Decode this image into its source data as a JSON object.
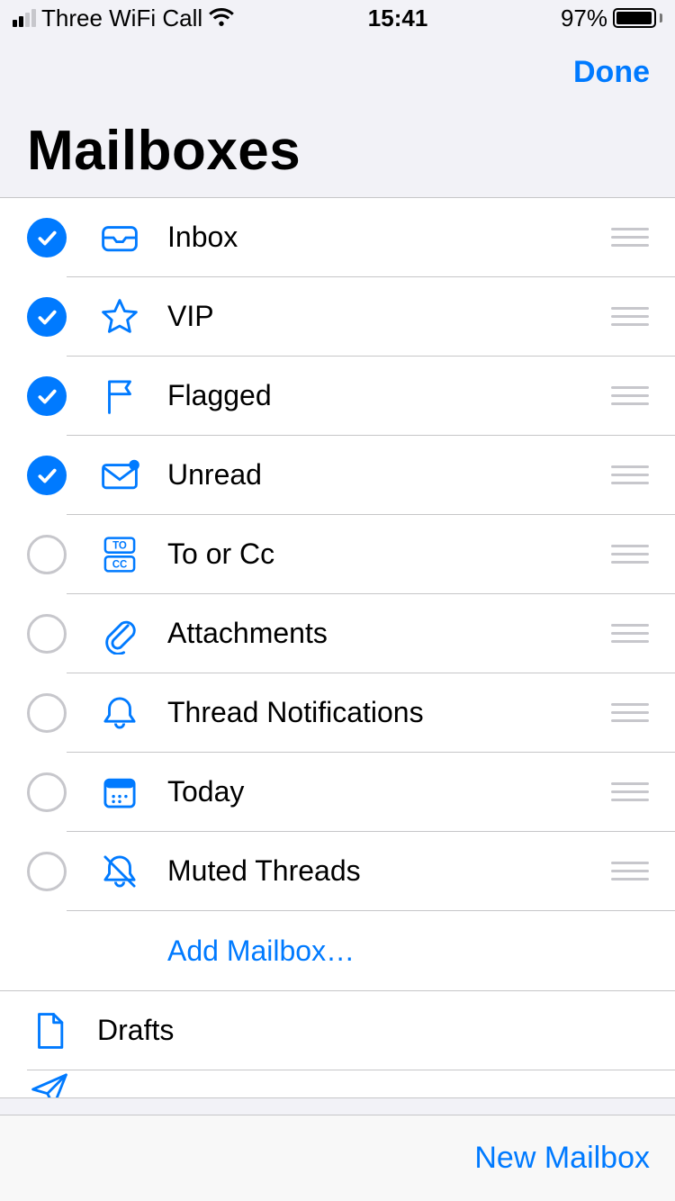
{
  "status_bar": {
    "carrier": "Three WiFi Call",
    "time": "15:41",
    "battery_pct": "97%"
  },
  "nav": {
    "done": "Done",
    "title": "Mailboxes"
  },
  "mailbox_list": [
    {
      "label": "Inbox",
      "icon": "inbox-icon",
      "checked": true
    },
    {
      "label": "VIP",
      "icon": "star-icon",
      "checked": true
    },
    {
      "label": "Flagged",
      "icon": "flag-icon",
      "checked": true
    },
    {
      "label": "Unread",
      "icon": "envelope-dot-icon",
      "checked": true
    },
    {
      "label": "To or Cc",
      "icon": "to-cc-icon",
      "checked": false
    },
    {
      "label": "Attachments",
      "icon": "paperclip-icon",
      "checked": false
    },
    {
      "label": "Thread Notifications",
      "icon": "bell-icon",
      "checked": false
    },
    {
      "label": "Today",
      "icon": "calendar-icon",
      "checked": false
    },
    {
      "label": "Muted Threads",
      "icon": "bell-slash-icon",
      "checked": false
    }
  ],
  "add_mailbox": "Add Mailbox…",
  "secondary_list": [
    {
      "label": "Drafts",
      "icon": "document-icon"
    }
  ],
  "peek_icon": "paperplane-icon",
  "toolbar": {
    "new_mailbox": "New Mailbox"
  },
  "colors": {
    "accent": "#007aff",
    "separator": "#c6c6c8",
    "inactive": "#c7c7cc"
  }
}
